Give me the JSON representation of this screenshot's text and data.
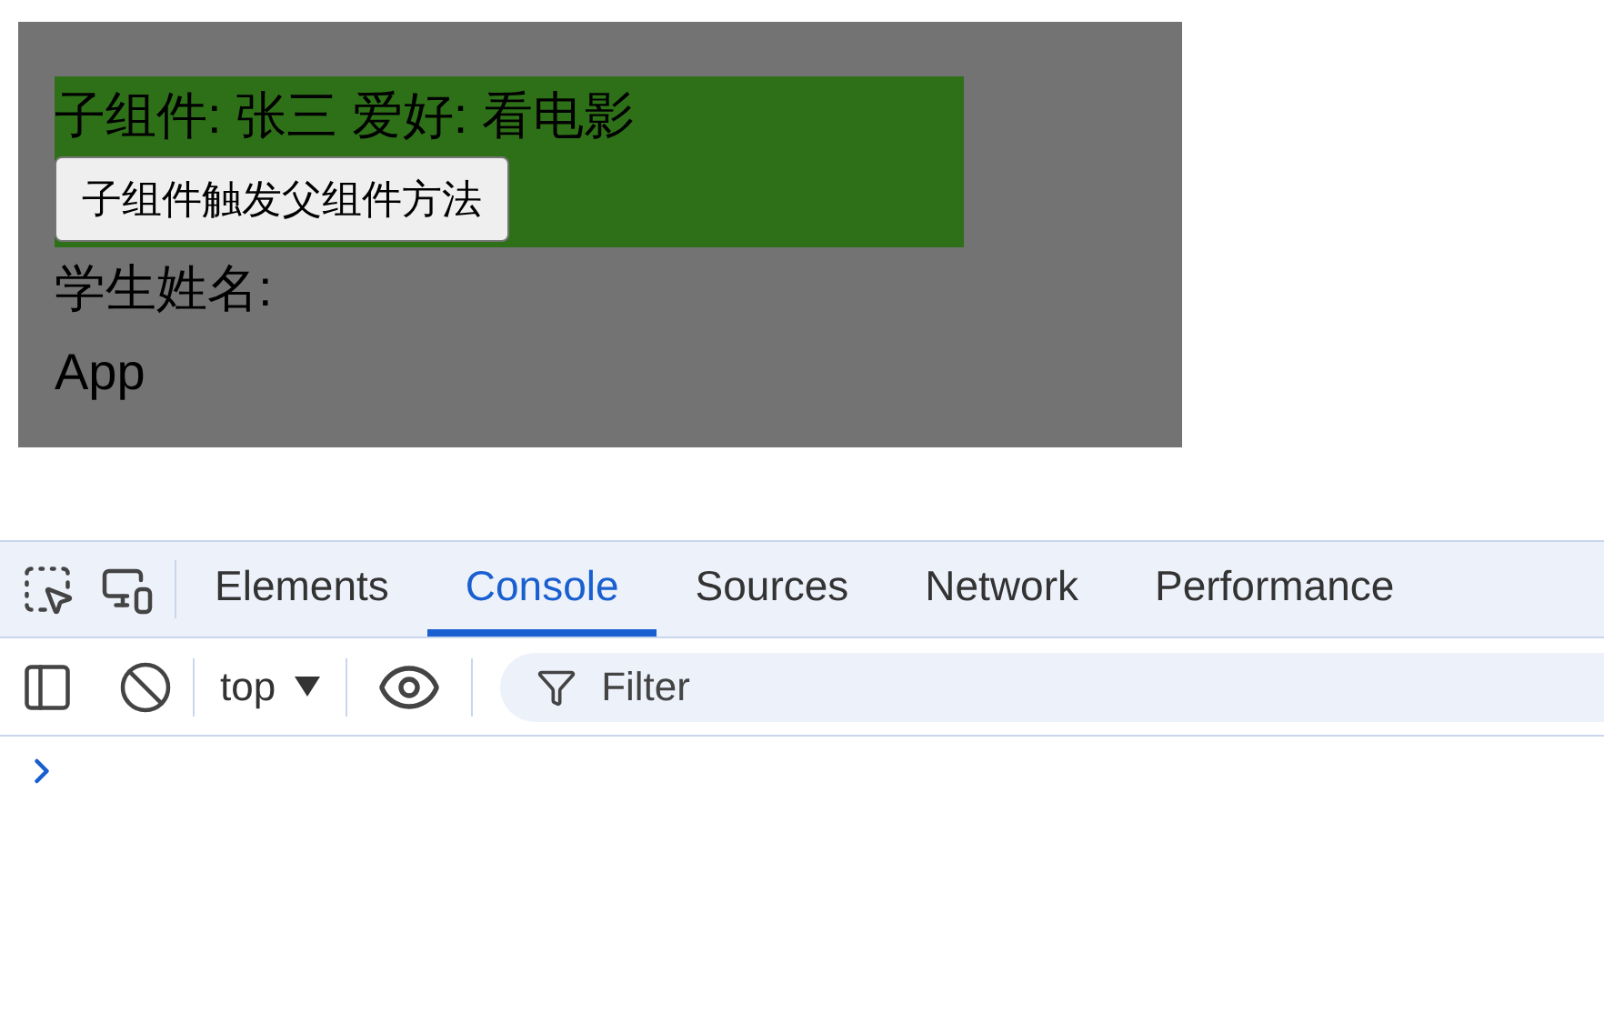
{
  "app": {
    "child": {
      "text": "子组件: 张三 爱好: 看电影",
      "button": "子组件触发父组件方法"
    },
    "student_label": "学生姓名:",
    "app_name": "App"
  },
  "devtools": {
    "tabs": [
      {
        "label": "Elements",
        "selected": false
      },
      {
        "label": "Console",
        "selected": true
      },
      {
        "label": "Sources",
        "selected": false
      },
      {
        "label": "Network",
        "selected": false
      },
      {
        "label": "Performance",
        "selected": false
      }
    ],
    "context": "top",
    "filter": {
      "placeholder": "Filter"
    }
  }
}
